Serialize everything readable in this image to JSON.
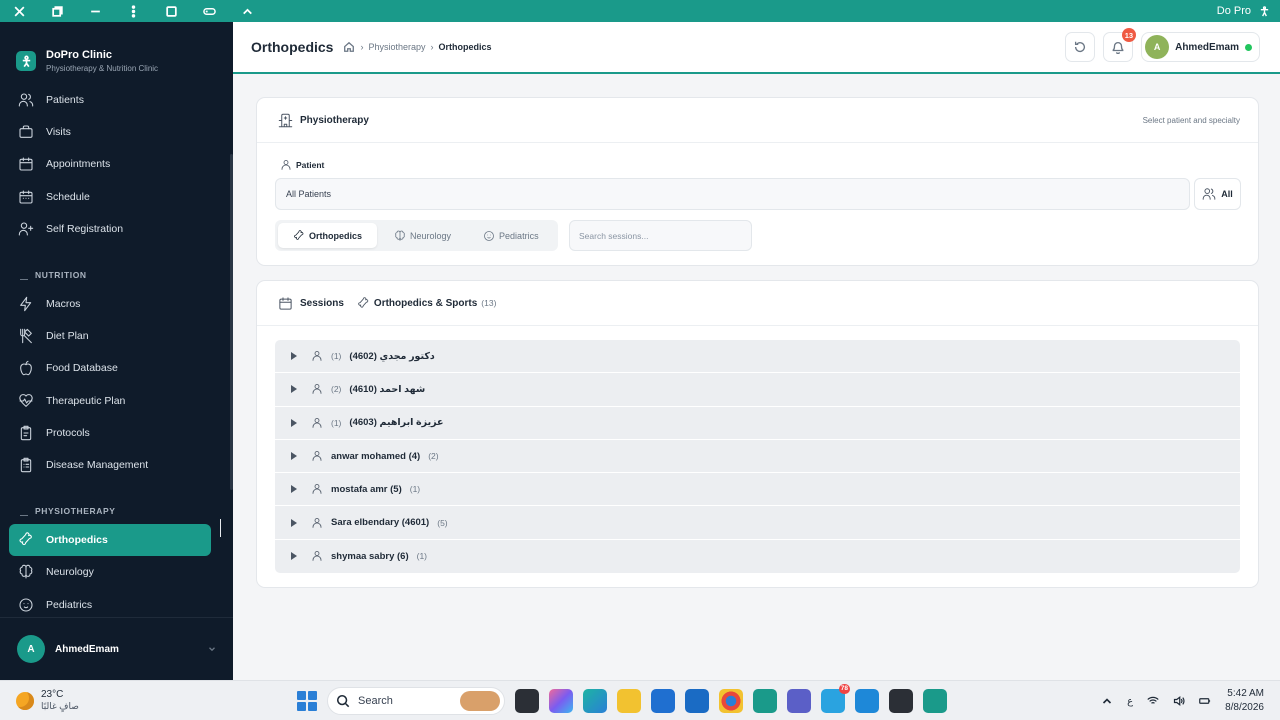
{
  "titlebar": {
    "app_name": "Do Pro"
  },
  "brand": {
    "title": "DoPro Clinic",
    "subtitle": "Physiotherapy & Nutrition Clinic"
  },
  "sidebar": {
    "main_items": [
      {
        "label": "Patients",
        "icon": "users-icon"
      },
      {
        "label": "Visits",
        "icon": "briefcase-icon"
      },
      {
        "label": "Appointments",
        "icon": "calendar-icon"
      },
      {
        "label": "Schedule",
        "icon": "calendar-days-icon"
      },
      {
        "label": "Self Registration",
        "icon": "user-plus-icon"
      }
    ],
    "nutrition_section": "NUTRITION",
    "nutrition_items": [
      {
        "label": "Macros",
        "icon": "zap-icon"
      },
      {
        "label": "Diet Plan",
        "icon": "utensils-icon"
      },
      {
        "label": "Food Database",
        "icon": "apple-icon"
      },
      {
        "label": "Therapeutic Plan",
        "icon": "heart-pulse-icon"
      },
      {
        "label": "Protocols",
        "icon": "clipboard-icon"
      },
      {
        "label": "Disease Management",
        "icon": "clipboard-list-icon"
      }
    ],
    "physio_section": "PHYSIOTHERAPY",
    "physio_items": [
      {
        "label": "Orthopedics",
        "icon": "bone-icon",
        "active": true
      },
      {
        "label": "Neurology",
        "icon": "brain-icon"
      },
      {
        "label": "Pediatrics",
        "icon": "baby-icon"
      }
    ],
    "user": {
      "initial": "A",
      "name": "AhmedEmam"
    }
  },
  "header": {
    "title": "Orthopedics",
    "breadcrumb": [
      "Physiotherapy",
      "Orthopedics"
    ],
    "notifications": "13",
    "user": {
      "initial": "A",
      "name": "AhmedEmam"
    }
  },
  "filter_card": {
    "title": "Physiotherapy",
    "hint": "Select patient and specialty",
    "patient_label": "Patient",
    "patient_value": "All Patients",
    "all_button": "All",
    "tabs": [
      "Orthopedics",
      "Neurology",
      "Pediatrics"
    ],
    "search_placeholder": "Search sessions..."
  },
  "sessions_card": {
    "title": "Sessions",
    "specialty": "Orthopedics & Sports",
    "count": "(13)",
    "rows": [
      {
        "name": "دكتور مجدي (4602)",
        "count": "(1)",
        "rtl": true
      },
      {
        "name": "شهد احمد (4610)",
        "count": "(2)",
        "rtl": true
      },
      {
        "name": "عزيزة ابراهيم (4603)",
        "count": "(1)",
        "rtl": true
      },
      {
        "name": "anwar mohamed (4)",
        "count": "(2)",
        "rtl": false
      },
      {
        "name": "mostafa amr (5)",
        "count": "(1)",
        "rtl": false
      },
      {
        "name": "Sara elbendary (4601)",
        "count": "(5)",
        "rtl": false
      },
      {
        "name": "shymaa sabry (6)",
        "count": "(1)",
        "rtl": false
      }
    ]
  },
  "taskbar": {
    "weather_temp": "23°C",
    "weather_desc": "صافٍ غالبًا",
    "search_label": "Search",
    "telegram_badge": "78",
    "lang": "ع",
    "time": "5:42 AM",
    "date": "8/8/2026"
  }
}
